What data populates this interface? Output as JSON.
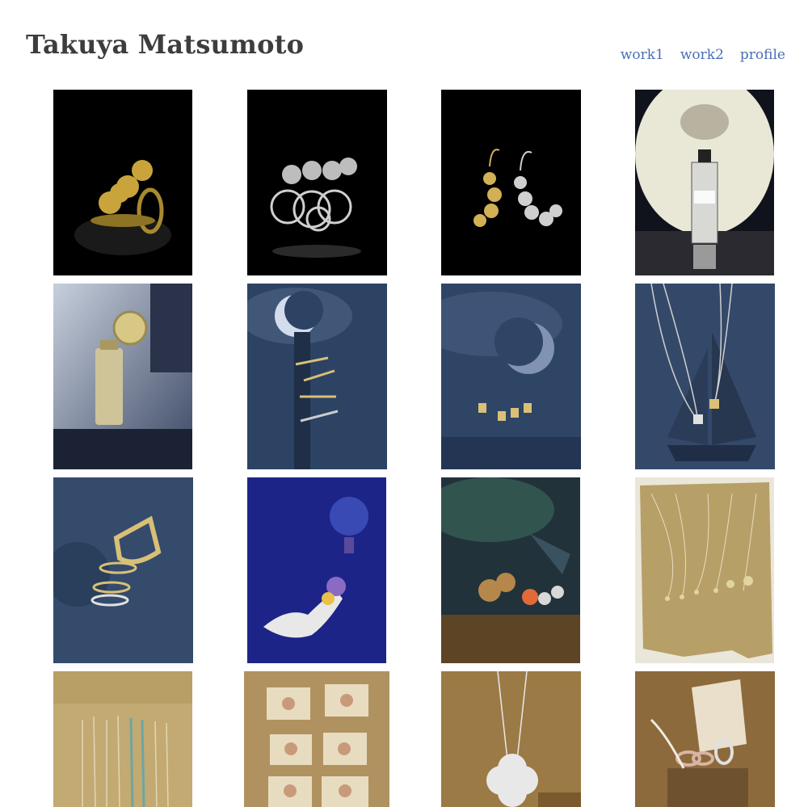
{
  "header": {
    "site_title": "Takuya Matsumoto",
    "nav": [
      {
        "label": "work1"
      },
      {
        "label": "work2"
      },
      {
        "label": "profile"
      }
    ]
  },
  "gallery": {
    "photos": [
      {
        "subject": "gold flower ring",
        "palette": [
          "#000000",
          "#121212",
          "#c9a43a"
        ]
      },
      {
        "subject": "silver flower rings",
        "palette": [
          "#000000",
          "#0d0d0d",
          "#c8c8c8"
        ]
      },
      {
        "subject": "gold and silver flower earrings",
        "palette": [
          "#000000",
          "#0b0b0b",
          "#d2b055"
        ]
      },
      {
        "subject": "perfume bottle on light",
        "palette": [
          "#f2f0e2",
          "#2a2a30",
          "#dcdcd8"
        ]
      },
      {
        "subject": "gold cosmetic bottle",
        "palette": [
          "#9aa4b8",
          "#2b3550",
          "#cfc39a"
        ]
      },
      {
        "subject": "rings under crescent moon",
        "palette": [
          "#3c5478",
          "#1c2b44",
          "#d9c076"
        ]
      },
      {
        "subject": "earrings under crescent moon",
        "palette": [
          "#3e567c",
          "#1f2e48",
          "#d9c076"
        ]
      },
      {
        "subject": "pendant necklaces with ship",
        "palette": [
          "#3e5778",
          "#1e2d45",
          "#d8d8d8"
        ]
      },
      {
        "subject": "gold rings on blue",
        "palette": [
          "#3b5273",
          "#1d2a40",
          "#d9c076"
        ]
      },
      {
        "subject": "bird brooch with balloon",
        "palette": [
          "#2a34a0",
          "#141a60",
          "#e8e8e8"
        ]
      },
      {
        "subject": "gem rings on pebbles",
        "palette": [
          "#2f4f50",
          "#1b2a33",
          "#b5874b"
        ]
      },
      {
        "subject": "pendants on parchment",
        "palette": [
          "#b7a067",
          "#8a7543",
          "#e6dcc0"
        ]
      },
      {
        "subject": "necklaces on parchment",
        "palette": [
          "#c2aa72",
          "#9b844f",
          "#e3d6b4"
        ]
      },
      {
        "subject": "clover jewelry on books",
        "palette": [
          "#b09260",
          "#876b3e",
          "#d9c7a0"
        ]
      },
      {
        "subject": "clover pendant necklace",
        "palette": [
          "#9c7a45",
          "#6c5128",
          "#e8e8e8"
        ]
      },
      {
        "subject": "rings on stacked books",
        "palette": [
          "#8c6a3b",
          "#5f4523",
          "#eadfcb"
        ]
      }
    ]
  }
}
